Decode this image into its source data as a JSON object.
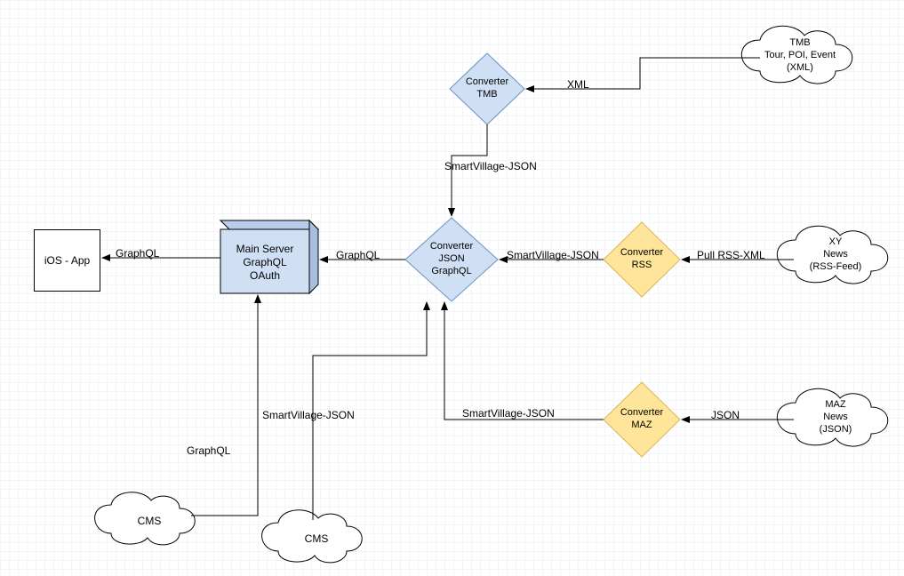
{
  "nodes": {
    "ios_app": "iOS - App",
    "main_server_l1": "Main Server",
    "main_server_l2": "GraphQL",
    "main_server_l3": "OAuth",
    "conv_tmb": "Converter\nTMB",
    "conv_json": "Converter\nJSON\nGraphQL",
    "conv_rss": "Converter\nRSS",
    "conv_maz": "Converter\nMAZ",
    "cloud_tmb_l1": "TMB",
    "cloud_tmb_l2": "Tour, POI, Event",
    "cloud_tmb_l3": "(XML)",
    "cloud_xy_l1": "XY",
    "cloud_xy_l2": "News",
    "cloud_xy_l3": "(RSS-Feed)",
    "cloud_maz_l1": "MAZ",
    "cloud_maz_l2": "News",
    "cloud_maz_l3": "(JSON)",
    "cloud_cms1": "CMS",
    "cloud_cms2": "CMS"
  },
  "edges": {
    "xml": "XML",
    "sv_json_tmb": "SmartVillage-JSON",
    "pull_rss": "Pull RSS-XML",
    "sv_json_rss": "SmartVillage-JSON",
    "json": "JSON",
    "sv_json_maz": "SmartVillage-JSON",
    "graphql_conv": "GraphQL",
    "graphql_app": "GraphQL",
    "graphql_cms": "GraphQL",
    "sv_json_cms": "SmartVillage-JSON"
  },
  "colors": {
    "blueFill": "#cfe0f4",
    "blueStroke": "#6a8fc3",
    "yellowFill": "#ffe599",
    "yellowStroke": "#d6b656",
    "box3dFill": "#cfe0f4",
    "box3dStroke": "#000"
  }
}
